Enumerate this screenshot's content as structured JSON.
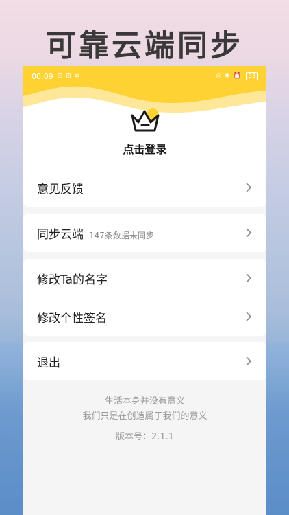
{
  "headline": "可靠云端同步",
  "status_bar": {
    "time": "00:09",
    "left_icons": "⊞ ⊞ ≋",
    "right_icons": "◎ ✱ ⏰",
    "battery": "93"
  },
  "profile": {
    "login_label": "点击登录"
  },
  "menu": {
    "feedback": "意见反馈",
    "sync": "同步云端",
    "sync_sub": "147条数据未同步",
    "rename": "修改Ta的名字",
    "signature": "修改个性签名",
    "logout": "退出"
  },
  "footer": {
    "line1": "生活本身并没有意义",
    "line2": "我们只是在创造属于我们的意义",
    "version": "版本号：2.1.1"
  },
  "colors": {
    "accent": "#ffd234",
    "accent_light": "#ffe88a"
  }
}
